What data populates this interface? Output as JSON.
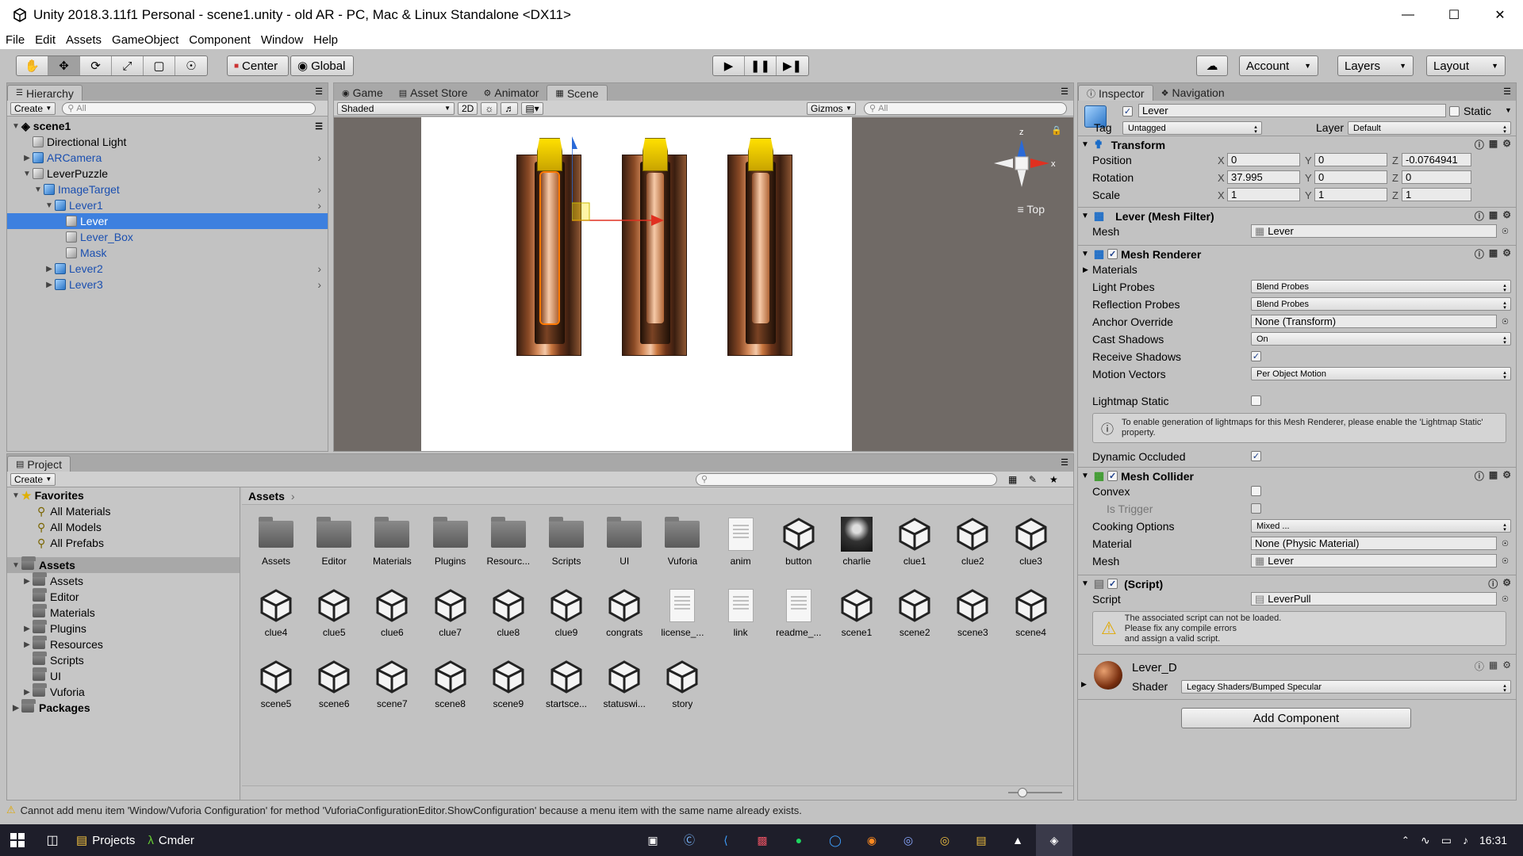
{
  "window": {
    "title": "Unity 2018.3.11f1 Personal - scene1.unity - old AR - PC, Mac & Linux Standalone <DX11>"
  },
  "menu": [
    "File",
    "Edit",
    "Assets",
    "GameObject",
    "Component",
    "Window",
    "Help"
  ],
  "toolbar": {
    "pivot": "Center",
    "space": "Global",
    "account": "Account",
    "layers": "Layers",
    "layout": "Layout"
  },
  "hierarchy": {
    "tab": "Hierarchy",
    "create": "Create",
    "search_placeholder": "All",
    "scene": "scene1",
    "items": [
      {
        "label": "Directional Light"
      },
      {
        "label": "ARCamera"
      },
      {
        "label": "LeverPuzzle"
      },
      {
        "label": "ImageTarget"
      },
      {
        "label": "Lever1"
      },
      {
        "label": "Lever"
      },
      {
        "label": "Lever_Box"
      },
      {
        "label": "Mask"
      },
      {
        "label": "Lever2"
      },
      {
        "label": "Lever3"
      }
    ]
  },
  "center_tabs": [
    "Game",
    "Asset Store",
    "Animator",
    "Scene"
  ],
  "scene": {
    "shading": "Shaded",
    "mode_2d": "2D",
    "gizmos": "Gizmos",
    "search_placeholder": "All",
    "view_label": "Top",
    "axis_z": "z",
    "axis_x": "x"
  },
  "project": {
    "tab": "Project",
    "create": "Create",
    "favorites_label": "Favorites",
    "favorites": [
      "All Materials",
      "All Models",
      "All Prefabs"
    ],
    "assets_label": "Assets",
    "asset_folders": [
      "Assets",
      "Editor",
      "Materials",
      "Plugins",
      "Resources",
      "Scripts",
      "UI",
      "Vuforia"
    ],
    "packages_label": "Packages",
    "breadcrumb": "Assets",
    "grid": [
      "Assets",
      "Editor",
      "Materials",
      "Plugins",
      "Resourc...",
      "Scripts",
      "UI",
      "Vuforia",
      "anim",
      "button",
      "charlie",
      "clue1",
      "clue2",
      "clue3",
      "clue4",
      "clue5",
      "clue6",
      "clue7",
      "clue8",
      "clue9",
      "congrats",
      "license_...",
      "link",
      "readme_...",
      "scene1",
      "scene2",
      "scene3",
      "scene4",
      "scene5",
      "scene6",
      "scene7",
      "scene8",
      "scene9",
      "startsce...",
      "statuswi...",
      "story"
    ],
    "grid_types": [
      "folder",
      "folder",
      "folder",
      "folder",
      "folder",
      "folder",
      "folder",
      "folder",
      "doc",
      "unity",
      "photo",
      "unity",
      "unity",
      "unity",
      "unity",
      "unity",
      "unity",
      "unity",
      "unity",
      "unity",
      "unity",
      "doc",
      "doc",
      "doc",
      "unity",
      "unity",
      "unity",
      "unity",
      "unity",
      "unity",
      "unity",
      "unity",
      "unity",
      "unity",
      "unity",
      "unity"
    ]
  },
  "inspector": {
    "tabs": [
      "Inspector",
      "Navigation"
    ],
    "object_name": "Lever",
    "static_label": "Static",
    "tag_label": "Tag",
    "tag_value": "Untagged",
    "layer_label": "Layer",
    "layer_value": "Default",
    "transform": {
      "title": "Transform",
      "position_label": "Position",
      "position": [
        "0",
        "0",
        "-0.0764941"
      ],
      "rotation_label": "Rotation",
      "rotation": [
        "37.995",
        "0",
        "0"
      ],
      "scale_label": "Scale",
      "scale": [
        "1",
        "1",
        "1"
      ]
    },
    "mesh_filter": {
      "title": "Lever (Mesh Filter)",
      "mesh_label": "Mesh",
      "mesh_value": "Lever"
    },
    "mesh_renderer": {
      "title": "Mesh Renderer",
      "materials": "Materials",
      "light_probes_label": "Light Probes",
      "light_probes": "Blend Probes",
      "reflection_probes_label": "Reflection Probes",
      "reflection_probes": "Blend Probes",
      "anchor_override_label": "Anchor Override",
      "anchor_override": "None (Transform)",
      "cast_shadows_label": "Cast Shadows",
      "cast_shadows": "On",
      "receive_shadows_label": "Receive Shadows",
      "motion_vectors_label": "Motion Vectors",
      "motion_vectors": "Per Object Motion",
      "lightmap_static_label": "Lightmap Static",
      "lightmap_help": "To enable generation of lightmaps for this Mesh Renderer, please enable the 'Lightmap Static' property.",
      "dynamic_occluded_label": "Dynamic Occluded"
    },
    "mesh_collider": {
      "title": "Mesh Collider",
      "convex_label": "Convex",
      "is_trigger_label": "Is Trigger",
      "cooking_label": "Cooking Options",
      "cooking": "Mixed ...",
      "material_label": "Material",
      "material": "None (Physic Material)",
      "mesh_label": "Mesh",
      "mesh": "Lever"
    },
    "script": {
      "title": "(Script)",
      "script_label": "Script",
      "script_value": "LeverPull",
      "warning": "The associated script can not be loaded.\nPlease fix any compile errors\nand assign a valid script."
    },
    "material": {
      "name": "Lever_D",
      "shader_label": "Shader",
      "shader": "Legacy Shaders/Bumped Specular"
    },
    "add_component": "Add Component"
  },
  "status": "Cannot add menu item 'Window/Vuforia Configuration' for method 'VuforiaConfigurationEditor.ShowConfiguration' because a menu item with the same name already exists.",
  "taskbar": {
    "projects": "Projects",
    "cmder": "Cmder",
    "time": "16:31"
  },
  "colors": {
    "selection": "#3d80df",
    "panel": "#c2c2c2",
    "taskbar": "#1e1e2a"
  }
}
